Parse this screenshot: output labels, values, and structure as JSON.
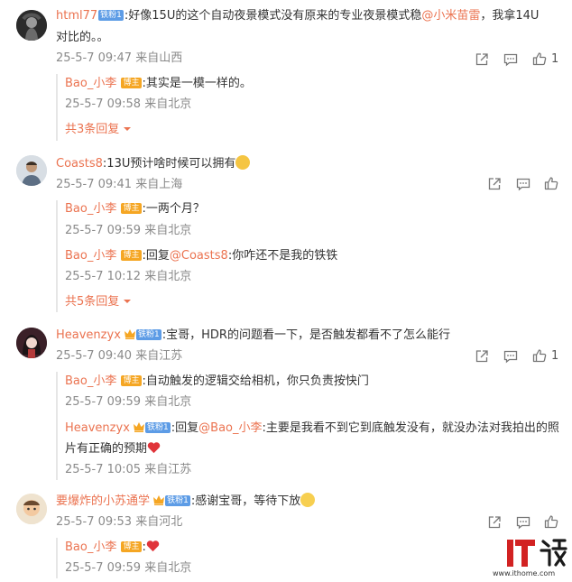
{
  "c1": {
    "user": "html77",
    "fan_badge": "铁粉1",
    "text_a": ":好像15U的这个自动夜景模式没有原来的专业夜景模式稳",
    "mention": "@小米苗雷",
    "text_b": "，我拿14U",
    "text_c": "对比的。。",
    "meta": "25-5-7 09:47 来自山西",
    "likes": "1",
    "reply1": {
      "user": "Bao_小李",
      "badge": "博主",
      "text": ":其实是一模一样的。",
      "meta": "25-5-7 09:58 来自北京"
    },
    "more": "共3条回复"
  },
  "c2": {
    "user": "Coasts8",
    "text": ":13U预计啥时候可以拥有",
    "meta": "25-5-7 09:41 来自上海",
    "reply1": {
      "user": "Bao_小李",
      "badge": "博主",
      "text": ":一两个月？",
      "meta": "25-5-7 09:59 来自北京"
    },
    "reply2": {
      "user": "Bao_小李",
      "badge": "博主",
      "pre": ":回复",
      "mention": "@Coasts8",
      "text": ":你咋还不是我的铁铁",
      "meta": "25-5-7 10:12 来自北京"
    },
    "more": "共5条回复"
  },
  "c3": {
    "user": "Heavenzyx",
    "fan_badge": "铁粉1",
    "text": ":宝哥，HDR的问题看一下，是否触发都看不了怎么能行",
    "meta": "25-5-7 09:40 来自江苏",
    "likes": "1",
    "reply1": {
      "user": "Bao_小李",
      "badge": "博主",
      "text": ":自动触发的逻辑交给相机，你只负责按快门",
      "meta": "25-5-7 09:59 来自北京"
    },
    "reply2": {
      "user": "Heavenzyx",
      "badge": "铁粉1",
      "pre": ":回复",
      "mention": "@Bao_小李",
      "text": ":主要是我看不到它到底触发没有，就没办法对我拍出的照",
      "text2": "片有正确的预期",
      "meta": "25-5-7 10:05 来自江苏"
    }
  },
  "c4": {
    "user": "要爆炸的小苏通学",
    "fan_badge": "铁粉1",
    "text": ":感谢宝哥，等待下放",
    "meta": "25-5-7 09:53 来自河北",
    "reply1": {
      "user": "Bao_小李",
      "badge": "博主",
      "text": ":",
      "meta": "25-5-7 09:59 来自北京"
    }
  },
  "watermark": {
    "brand": "IT之家",
    "url": "www.ithome.com"
  },
  "colors": {
    "accent": "#eb7350",
    "meta": "#8a8a8a",
    "reply_bg": "#f7f7f7"
  },
  "icons": [
    "forward-icon",
    "comment-icon",
    "like-icon",
    "chevron-down-icon",
    "heart-emoji",
    "laugh-emoji",
    "smile-emoji"
  ]
}
